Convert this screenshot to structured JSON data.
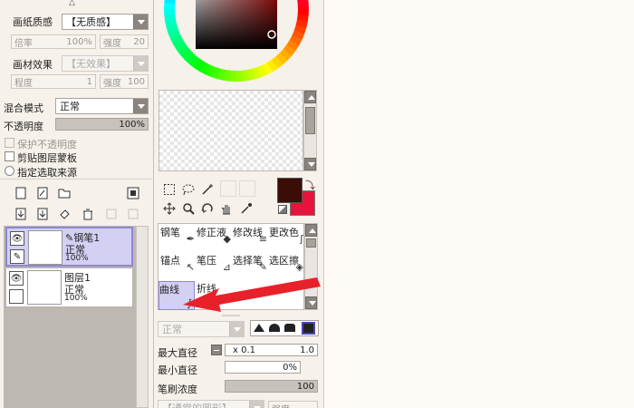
{
  "left_panel": {
    "paper_texture": {
      "label": "画纸质感",
      "value": "【无质感】"
    },
    "scale": {
      "label": "倍率",
      "value": "100%"
    },
    "strength1": {
      "label": "强度",
      "value": "20"
    },
    "material_effect": {
      "label": "画材效果",
      "value": "【无效果】"
    },
    "degree": {
      "label": "程度",
      "value": "1"
    },
    "strength2": {
      "label": "强度",
      "value": "100"
    },
    "blend_mode": {
      "label": "混合模式",
      "value": "正常"
    },
    "opacity": {
      "label": "不透明度",
      "value": "100%",
      "fraction": 1.0
    },
    "protect_opacity": "保护不透明度",
    "clip_mask": "剪贴图层蒙板",
    "selection_source": "指定选取来源"
  },
  "layers": [
    {
      "name": "钢笔1",
      "mode": "正常",
      "opacity": "100%",
      "selected": true
    },
    {
      "name": "图层1",
      "mode": "正常",
      "opacity": "100%",
      "selected": false
    }
  ],
  "tools": {
    "row1": [
      "钢笔",
      "修正液",
      "修改线",
      "更改色"
    ],
    "row2": [
      "锚点",
      "笔压",
      "选择笔",
      "选区擦"
    ],
    "row3": [
      "曲线",
      "折线"
    ]
  },
  "brush": {
    "mode": "正常",
    "max_diameter": {
      "label": "最大直径",
      "multiplier": "x 0.1",
      "value": "1.0"
    },
    "min_diameter": {
      "label": "最小直径",
      "value": "0%"
    },
    "density": {
      "label": "笔刷浓度",
      "value": "100",
      "fraction": 1.0
    },
    "bottom_combo": "【通常的圆形】",
    "bottom_strength": "强度"
  },
  "colors": {
    "primary": "#3a0d08",
    "secondary": "#e8123c",
    "accent": "#e8202a",
    "selection": "#d2d0f3"
  },
  "icons": {
    "file_new": "new-layer-icon",
    "folder": "folder-icon",
    "trash": "trash-icon"
  }
}
